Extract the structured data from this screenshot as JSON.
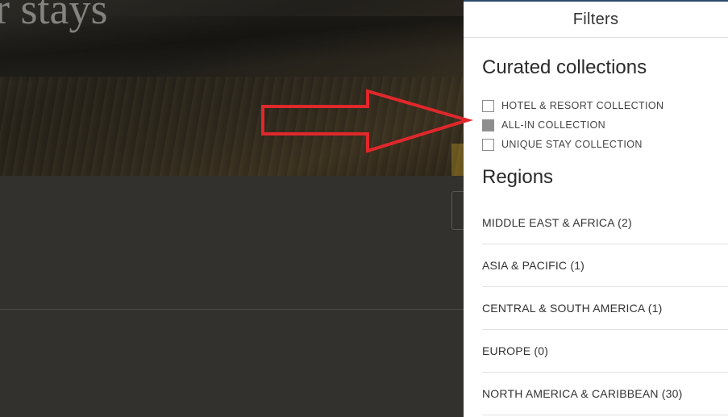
{
  "hero": {
    "title": "r stays"
  },
  "filters": {
    "header": "Filters",
    "collections_title": "Curated collections",
    "collections": [
      {
        "label": "HOTEL & RESORT COLLECTION",
        "checked": false
      },
      {
        "label": "ALL-IN COLLECTION",
        "checked": true
      },
      {
        "label": "UNIQUE STAY COLLECTION",
        "checked": false
      }
    ],
    "regions_title": "Regions",
    "regions": [
      {
        "label": "MIDDLE EAST & AFRICA (2)"
      },
      {
        "label": "ASIA & PACIFIC (1)"
      },
      {
        "label": "CENTRAL & SOUTH AMERICA (1)"
      },
      {
        "label": "EUROPE (0)"
      },
      {
        "label": "NORTH AMERICA & CARIBBEAN (30)"
      }
    ]
  },
  "colors": {
    "arrow": "#e0282c",
    "checked_box": "#8e8e8e",
    "panel_accent": "#2b4a6b"
  },
  "icons": {
    "annotation": "right-arrow-icon"
  }
}
